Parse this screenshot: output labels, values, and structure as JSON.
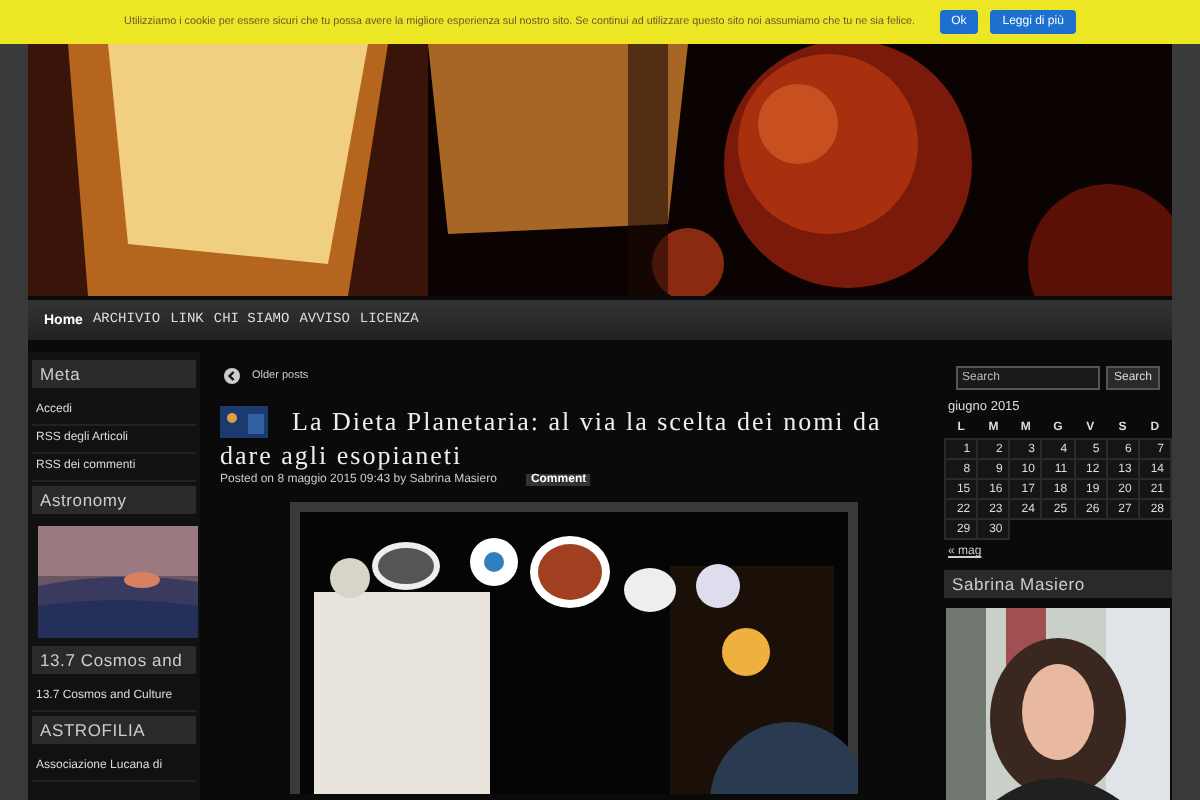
{
  "cookie_bar": {
    "message": "Utilizziamo i cookie per essere sicuri che tu possa avere la migliore esperienza sul nostro sito. Se continui ad utilizzare questo sito noi assumiamo che tu ne sia felice.",
    "buttons": [
      "Ok",
      "Leggi di più"
    ]
  },
  "nav": [
    {
      "label": "Home",
      "selected": true
    },
    {
      "label": "ARCHIVIO",
      "selected": false
    },
    {
      "label": "LINK",
      "selected": false
    },
    {
      "label": "CHI SIAMO",
      "selected": false
    },
    {
      "label": "AVVISO",
      "selected": false
    },
    {
      "label": "LICENZA",
      "selected": false
    }
  ],
  "left_sidebar": [
    {
      "title": "Meta",
      "links": [
        "Accedi",
        "RSS degli Articoli",
        "RSS dei commenti"
      ]
    },
    {
      "title": "Astronomy",
      "kind": "picture"
    },
    {
      "title": "13.7 Cosmos and",
      "links": [
        "13.7 Cosmos and Culture"
      ]
    },
    {
      "title": "ASTROFILIA",
      "links": [
        "Associazione Lucana di"
      ]
    }
  ],
  "content": {
    "older_posts": "Older posts",
    "post": {
      "title": "La Dieta Planetaria: al via la scelta dei nomi da dare agli esopianeti",
      "meta": "Posted on 8 maggio 2015 09:43 by Sabrina Masiero",
      "comment": "Comment"
    }
  },
  "right_sidebar": {
    "search": {
      "placeholder": "Search",
      "button": "Search"
    },
    "calendar": {
      "caption": "giugno 2015",
      "headers": [
        "L",
        "M",
        "M",
        "G",
        "V",
        "S",
        "D"
      ],
      "weeks": [
        [
          "1",
          "2",
          "3",
          "4",
          "5",
          "6",
          "7"
        ],
        [
          "8",
          "9",
          "10",
          "11",
          "12",
          "13",
          "14"
        ],
        [
          "15",
          "16",
          "17",
          "18",
          "19",
          "20",
          "21"
        ],
        [
          "22",
          "23",
          "24",
          "25",
          "26",
          "27",
          "28"
        ],
        [
          "29",
          "30"
        ]
      ],
      "prev": "« mag"
    },
    "author": {
      "title": "Sabrina Masiero"
    }
  }
}
